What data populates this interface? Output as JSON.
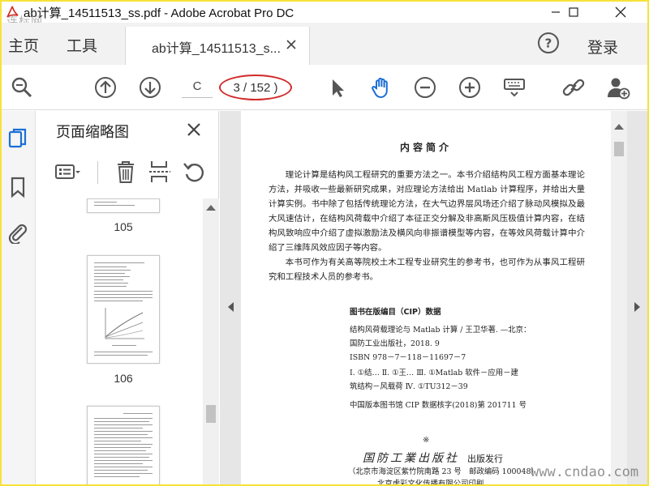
{
  "window": {
    "title": "ab计算_14511513_ss.pdf - Adobe Acrobat Pro DC",
    "watermark_top": "连标网",
    "watermark_bottom": "www.cndao.com"
  },
  "menubar": {
    "home": "主页",
    "tools": "工具",
    "doc_tab": "ab计算_14511513_s...",
    "login": "登录"
  },
  "toolbar": {
    "current_page": "C",
    "page_count": "3 / 152 )"
  },
  "thumbnails": {
    "title": "页面缩略图",
    "labels": [
      "105",
      "106"
    ]
  },
  "document": {
    "title": "内容简介",
    "intro_lines": [
      "理论计算是结构风工程研究的重要方法之一。本书介绍结构风工程方面基",
      "本理论方法，并吸收一些最新研究成果，对应理论方法给出 Matlab 计算程序，并",
      "给出大量计算实例。书中除了包括传统理论方法，在大气边界层风场还介绍了",
      "脉动风模拟及最大风速估计，在结构风荷载中介绍了本征正交分解及非高斯风",
      "压极值计算内容，在结构风致响应中介绍了虚拟激励法及横风向非振谱模型",
      "等内容，在等效风荷载计算中介绍了三维阵风效应因子等内容。"
    ],
    "audience_lines": [
      "本书可作为有关高等院校土木工程专业研究生的参考书，也可作为从事风工程",
      "研究和工程技术人员的参考书。"
    ],
    "cip_heading": "图书在版编目（CIP）数据",
    "cip_lines": [
      "结构风荷载理论与 Matlab 计算 / 王卫华著. —北京：",
      "国防工业出版社，2018. 9",
      "ISBN 978－7－118－11697－7"
    ],
    "cip_class_lines": [
      "Ⅰ. ①结…  Ⅱ. ①王…  Ⅲ. ①Matlab 软件－应用－建",
      "筑结构－风载荷  Ⅳ. ①TU312－39"
    ],
    "cip_number": "中国版本图书馆 CIP 数据核字(2018)第 201711 号",
    "star": "※",
    "publisher_logo": "国防工業出版社",
    "publisher_suffix": "出版发行",
    "address": "（北京市海淀区紫竹院南路 23 号　邮政编码 100048）",
    "printer": "北京虎彩文化传播有限公司印刷"
  },
  "colors": {
    "frame_border": "#f6e23a",
    "accent_blue": "#1b6fd6",
    "highlight_red": "#d12b2b",
    "icon_gray": "#555555"
  }
}
